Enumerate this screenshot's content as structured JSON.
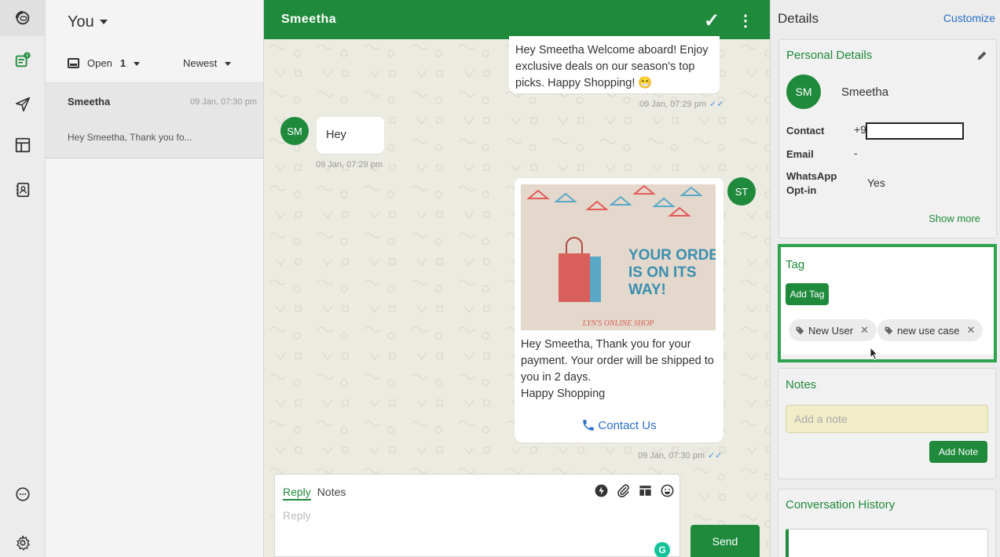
{
  "rail": {
    "items": [
      {
        "name": "logo",
        "active": true
      },
      {
        "name": "inbox",
        "badge": "4"
      },
      {
        "name": "campaigns"
      },
      {
        "name": "templates"
      },
      {
        "name": "contacts"
      },
      {
        "name": "chat-support"
      },
      {
        "name": "settings"
      }
    ]
  },
  "conversations": {
    "assignee": "You",
    "filter_label": "Open",
    "filter_count": "1",
    "sort_label": "Newest",
    "items": [
      {
        "name": "Smeetha",
        "time": "09 Jan, 07:30 pm",
        "preview": "Hey Smeetha, Thank you fo..."
      }
    ]
  },
  "chat": {
    "contact_name": "Smeetha",
    "messages": [
      {
        "text": "Hey Smeetha Welcome aboard! Enjoy exclusive deals on our season's top picks. Happy Shopping! 😁",
        "time": "09 Jan, 07:29 pm"
      },
      {
        "avatar": "SM",
        "text": "Hey",
        "time": "09 Jan, 07:29 pm"
      },
      {
        "avatar": "ST",
        "image_title": "YOUR ORDER IS ON ITS WAY!",
        "image_caption": "LYN'S ONLINE SHOP",
        "text": "Hey Smeetha, Thank you for your payment. Your order will be shipped to you in 2 days.",
        "text2": "Happy Shopping",
        "button": "Contact Us",
        "time": "09 Jan, 07:30 pm"
      }
    ],
    "reply": {
      "tab_reply": "Reply",
      "tab_notes": "Notes",
      "placeholder": "Reply",
      "send_label": "Send"
    }
  },
  "details": {
    "title": "Details",
    "customize": "Customize",
    "personal": {
      "title": "Personal Details",
      "avatar": "SM",
      "name": "Smeetha",
      "contact_label": "Contact",
      "contact_value": "+9",
      "email_label": "Email",
      "email_value": "-",
      "optin_label": "WhatsApp Opt-in",
      "optin_value": "Yes",
      "show_more": "Show more"
    },
    "tag": {
      "title": "Tag",
      "add_label": "Add Tag",
      "tags": [
        "New User",
        "new use case"
      ]
    },
    "notes": {
      "title": "Notes",
      "placeholder": "Add a note",
      "add_label": "Add Note"
    },
    "history": {
      "title": "Conversation History"
    }
  },
  "colors": {
    "brand": "#1f8a3c",
    "link": "#2a6fca",
    "highlight": "#2ea44f"
  }
}
